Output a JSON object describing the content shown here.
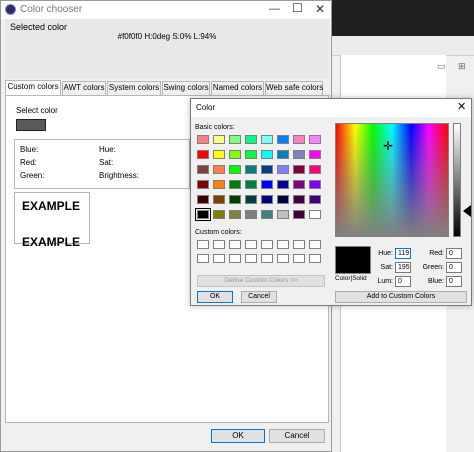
{
  "chooser": {
    "title": "Color chooser",
    "selected_label": "Selected color",
    "selected_value": "#f0f0f0 H:0deg S:0% L:94%",
    "tabs": [
      "Custom colors",
      "AWT colors",
      "System colors",
      "Swing colors",
      "Named colors",
      "Web safe colors"
    ],
    "select_color_label": "Select color",
    "selected_swatch_color": "#595959",
    "info": {
      "blue": "Blue:",
      "red": "Red:",
      "green": "Green:",
      "hue": "Hue:",
      "sat": "Sat:",
      "brightness": "Brightness:"
    },
    "example_1": "EXAMPLE",
    "example_2": "EXAMPLE",
    "ok": "OK",
    "cancel": "Cancel"
  },
  "dialog": {
    "title": "Color",
    "basic_colors_label": "Basic colors:",
    "custom_colors_label": "Custom colors:",
    "define_custom": "Define Custom Colors >>",
    "ok": "OK",
    "cancel": "Cancel",
    "color_solid_label": "Color|Solid",
    "fields": {
      "hue_label": "Hue:",
      "hue": "119",
      "sat_label": "Sat:",
      "sat": "195",
      "lum_label": "Lum:",
      "lum": "0",
      "red_label": "Red:",
      "red": "0",
      "green_label": "Green:",
      "green": "0",
      "blue_label": "Blue:",
      "blue": "0"
    },
    "add_custom": "Add to Custom Colors",
    "basic_colors": [
      [
        "#ff8080",
        "#ffff80",
        "#80ff80",
        "#00ff80",
        "#80ffff",
        "#0080ff",
        "#ff80c0",
        "#ff80ff"
      ],
      [
        "#ff0000",
        "#ffff00",
        "#80ff00",
        "#00ff40",
        "#00ffff",
        "#0080c0",
        "#8080c0",
        "#ff00ff"
      ],
      [
        "#804040",
        "#ff8040",
        "#00ff00",
        "#008080",
        "#004080",
        "#8080ff",
        "#800040",
        "#ff0080"
      ],
      [
        "#800000",
        "#ff8000",
        "#008000",
        "#008040",
        "#0000ff",
        "#0000a0",
        "#800080",
        "#8000ff"
      ],
      [
        "#400000",
        "#804000",
        "#004000",
        "#004040",
        "#000080",
        "#000040",
        "#400040",
        "#400080"
      ],
      [
        "#000000",
        "#808000",
        "#808040",
        "#808080",
        "#408080",
        "#c0c0c0",
        "#400040",
        "#ffffff"
      ]
    ],
    "selected_basic": "#000000"
  }
}
